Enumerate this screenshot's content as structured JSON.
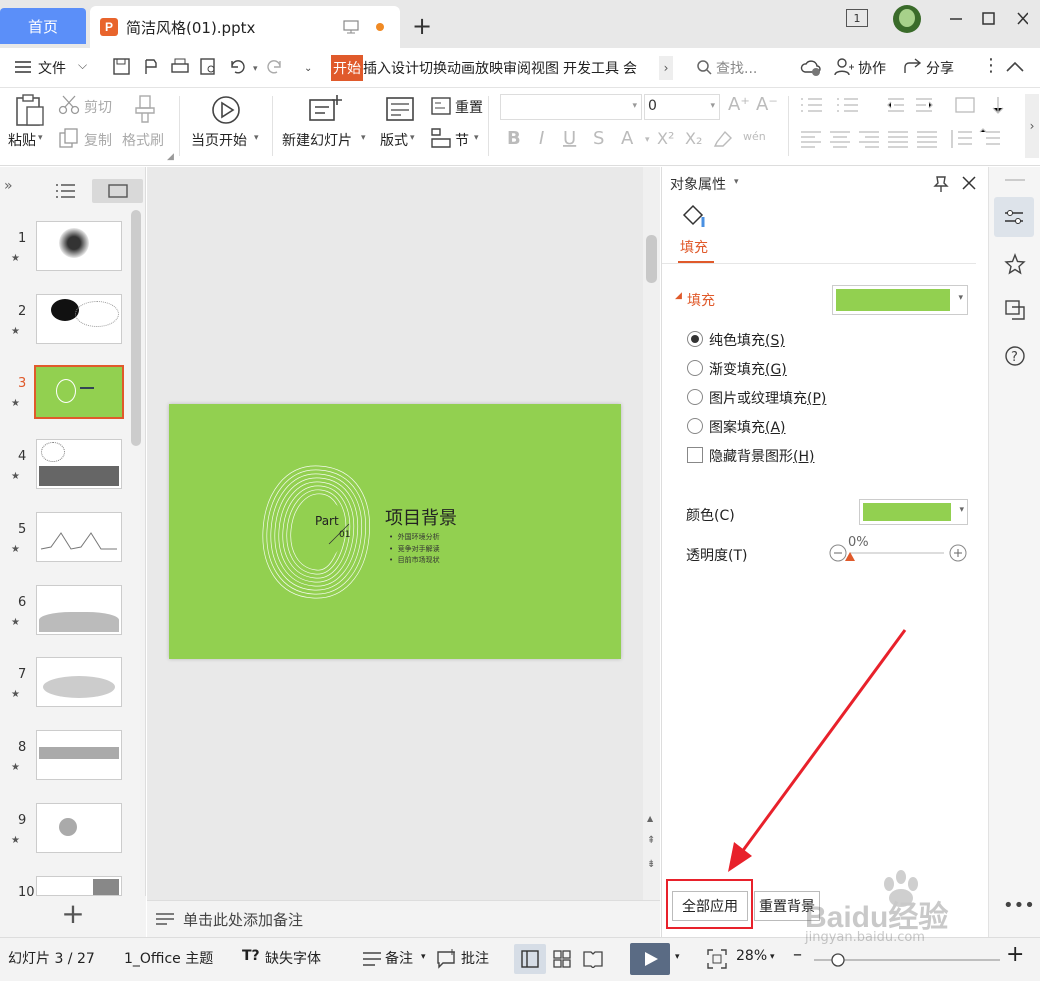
{
  "titlebar": {
    "home_tab": "首页",
    "doc_tab": "简洁风格(01).pptx",
    "doc_icon": "P",
    "window_count": "1"
  },
  "menu": {
    "file": "文件",
    "tabs": [
      "开始",
      "插入",
      "设计",
      "切换",
      "动画",
      "放映",
      "审阅",
      "视图",
      "开发工具",
      "会"
    ],
    "search": "查找...",
    "collab": "协作",
    "share": "分享"
  },
  "ribbon": {
    "paste": "粘贴",
    "cut": "剪切",
    "copy": "复制",
    "format_painter": "格式刷",
    "play_from_current": "当页开始",
    "new_slide": "新建幻灯片",
    "layout": "版式",
    "reset": "重置",
    "section": "节",
    "font_size": "0"
  },
  "slides": {
    "numbers": [
      "1",
      "2",
      "3",
      "4",
      "5",
      "6",
      "7",
      "8",
      "9",
      "10"
    ],
    "selected": 3
  },
  "slide": {
    "part": "Part",
    "num": "01",
    "title": "项目背景",
    "bullets": [
      "外国环境分析",
      "竞争对手解读",
      "目前市场现状"
    ]
  },
  "notes": {
    "placeholder": "单击此处添加备注"
  },
  "props": {
    "title": "对象属性",
    "tab_fill": "填充",
    "section": "填充",
    "options": [
      "纯色填充",
      "渐变填充",
      "图片或纹理填充",
      "图案填充"
    ],
    "shortcuts": [
      "(S)",
      "(G)",
      "(P)",
      "(A)"
    ],
    "hide_bg": "隐藏背景图形",
    "hide_bg_key": "(H)",
    "color_label": "颜色(C)",
    "transparency_label": "透明度(T)",
    "transparency_value": "0%",
    "apply_all": "全部应用",
    "reset_bg": "重置背景",
    "fill_color": "#92d050"
  },
  "status": {
    "slide_info": "幻灯片 3 / 27",
    "theme": "1_Office 主题",
    "missing_font": "缺失字体",
    "notes": "备注",
    "comments": "批注",
    "zoom": "28%"
  },
  "watermark": {
    "logo": "Baidu经验",
    "url": "jingyan.baidu.com"
  },
  "colors": {
    "accent": "#e05a2b",
    "slide_bg": "#92d050",
    "arrow": "#e8212b"
  }
}
